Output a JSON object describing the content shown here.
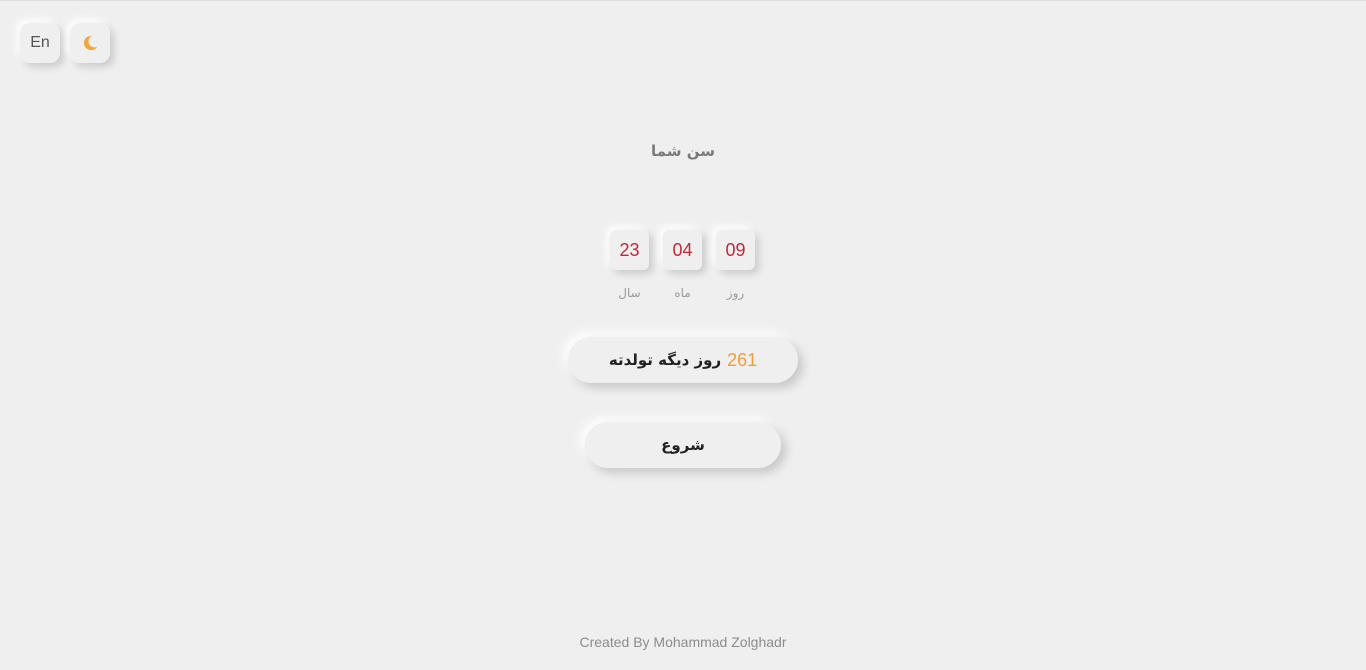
{
  "controls": {
    "language_label": "En",
    "theme_icon": "moon-icon",
    "theme_color": "#f3a43a"
  },
  "age": {
    "title": "سن شما",
    "items": [
      {
        "value": "23",
        "label": "سال"
      },
      {
        "value": "04",
        "label": "ماه"
      },
      {
        "value": "09",
        "label": "روز"
      }
    ],
    "value_color": "#c0283c"
  },
  "countdown": {
    "days": "261",
    "text": "روز دیگه تولدته",
    "number_color": "#f39b3b"
  },
  "start_button": {
    "label": "شروع"
  },
  "footer": {
    "credit": "Created By Mohammad Zolghadr"
  }
}
